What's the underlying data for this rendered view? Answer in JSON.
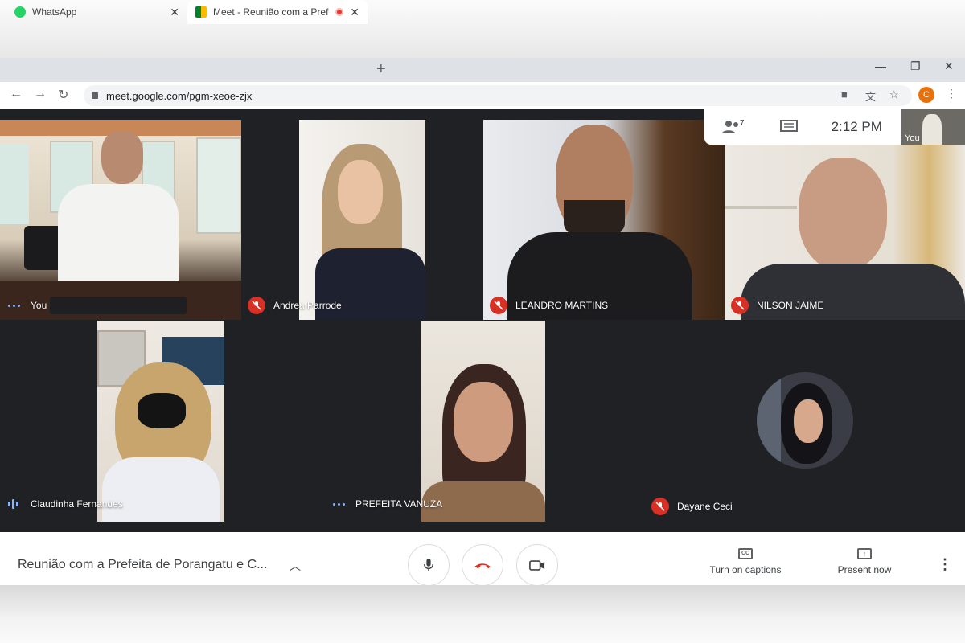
{
  "browser": {
    "tabs": [
      {
        "title": "WhatsApp",
        "icon": "whatsapp-icon",
        "color": "#25d366"
      },
      {
        "title": "Meet - Reunião com a Prefei",
        "icon": "meet-icon",
        "color": "#00832d"
      }
    ],
    "url": "meet.google.com/pgm-xeoe-zjx",
    "profile_initial": "C"
  },
  "meet": {
    "clock": "2:12 PM",
    "participant_count": "7",
    "self_preview_label": "You",
    "participants": [
      {
        "name": "You",
        "status": "speaking-dots"
      },
      {
        "name": "Andrea Parrode",
        "status": "muted"
      },
      {
        "name": "LEANDRO MARTINS",
        "status": "muted"
      },
      {
        "name": "NILSON JAIME",
        "status": "muted"
      },
      {
        "name": "Claudinha Fernandes",
        "status": "speaking-bars"
      },
      {
        "name": "PREFEITA VANUZA",
        "status": "speaking-dots"
      },
      {
        "name": "Dayane Ceci",
        "status": "muted"
      }
    ],
    "meeting_title": "Reunião com a Prefeita de Porangatu e C...",
    "captions_label": "Turn on captions",
    "present_label": "Present now",
    "colors": {
      "hangup": "#d93025",
      "muted_badge": "#d93025",
      "accent": "#8ab4f8"
    }
  }
}
